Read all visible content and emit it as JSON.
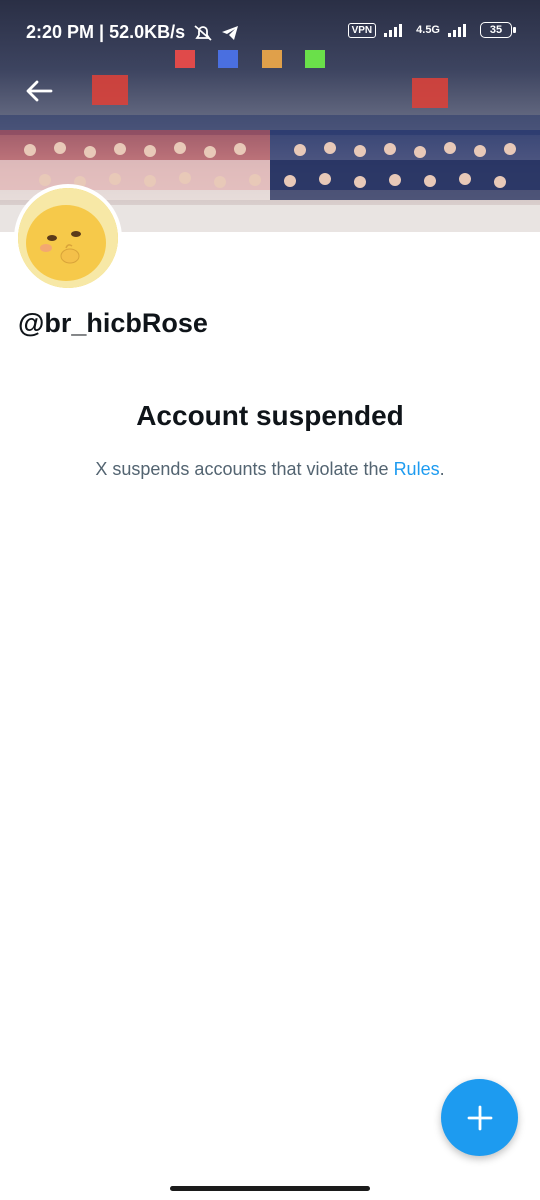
{
  "statusbar": {
    "time": "2:20 PM | 52.0KB/s",
    "vpn": "VPN",
    "network": "4.5G",
    "battery": "35"
  },
  "profile": {
    "handle": "@br_hicbRose"
  },
  "notice": {
    "title": "Account suspended",
    "text_before": "X suspends accounts that violate the ",
    "link": "Rules",
    "text_after": "."
  },
  "colors": {
    "accent": "#1d9bf0",
    "secondary_text": "#536471"
  },
  "icons": {
    "back": "arrow-left-icon",
    "compose": "plus-icon"
  }
}
